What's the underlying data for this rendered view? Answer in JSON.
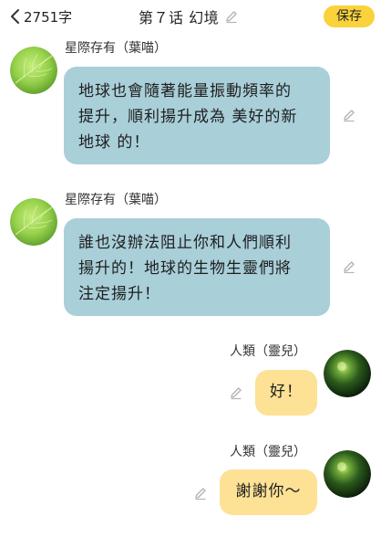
{
  "header": {
    "back_count": "2751字",
    "chapter_title": "第７话 幻境",
    "save_label": "保存"
  },
  "messages": [
    {
      "side": "left",
      "name": "星際存有（葉喵）",
      "text": "地球也會隨著能量振動頻率的\n提升，順利揚升成為 美好的新\n地球 的！"
    },
    {
      "side": "left",
      "name": "星際存有（葉喵）",
      "text": "誰也沒辦法阻止你和人們順利\n揚升的！地球的生物生靈們將\n注定揚升！"
    },
    {
      "side": "right",
      "name": "人類（靈兒）",
      "text": "好！"
    },
    {
      "side": "right",
      "name": "人類（靈兒）",
      "text": "謝謝你～"
    }
  ],
  "icons": {
    "back": "chevron-left-icon",
    "edit": "pencil-icon",
    "left_avatar": "green-leaf-avatar",
    "right_avatar": "dark-green-sphere-avatar"
  },
  "colors": {
    "save_button": "#f9d23c",
    "left_bubble": "#a9cfd9",
    "right_bubble": "#fde195",
    "pencil": "#b5b5b5"
  }
}
